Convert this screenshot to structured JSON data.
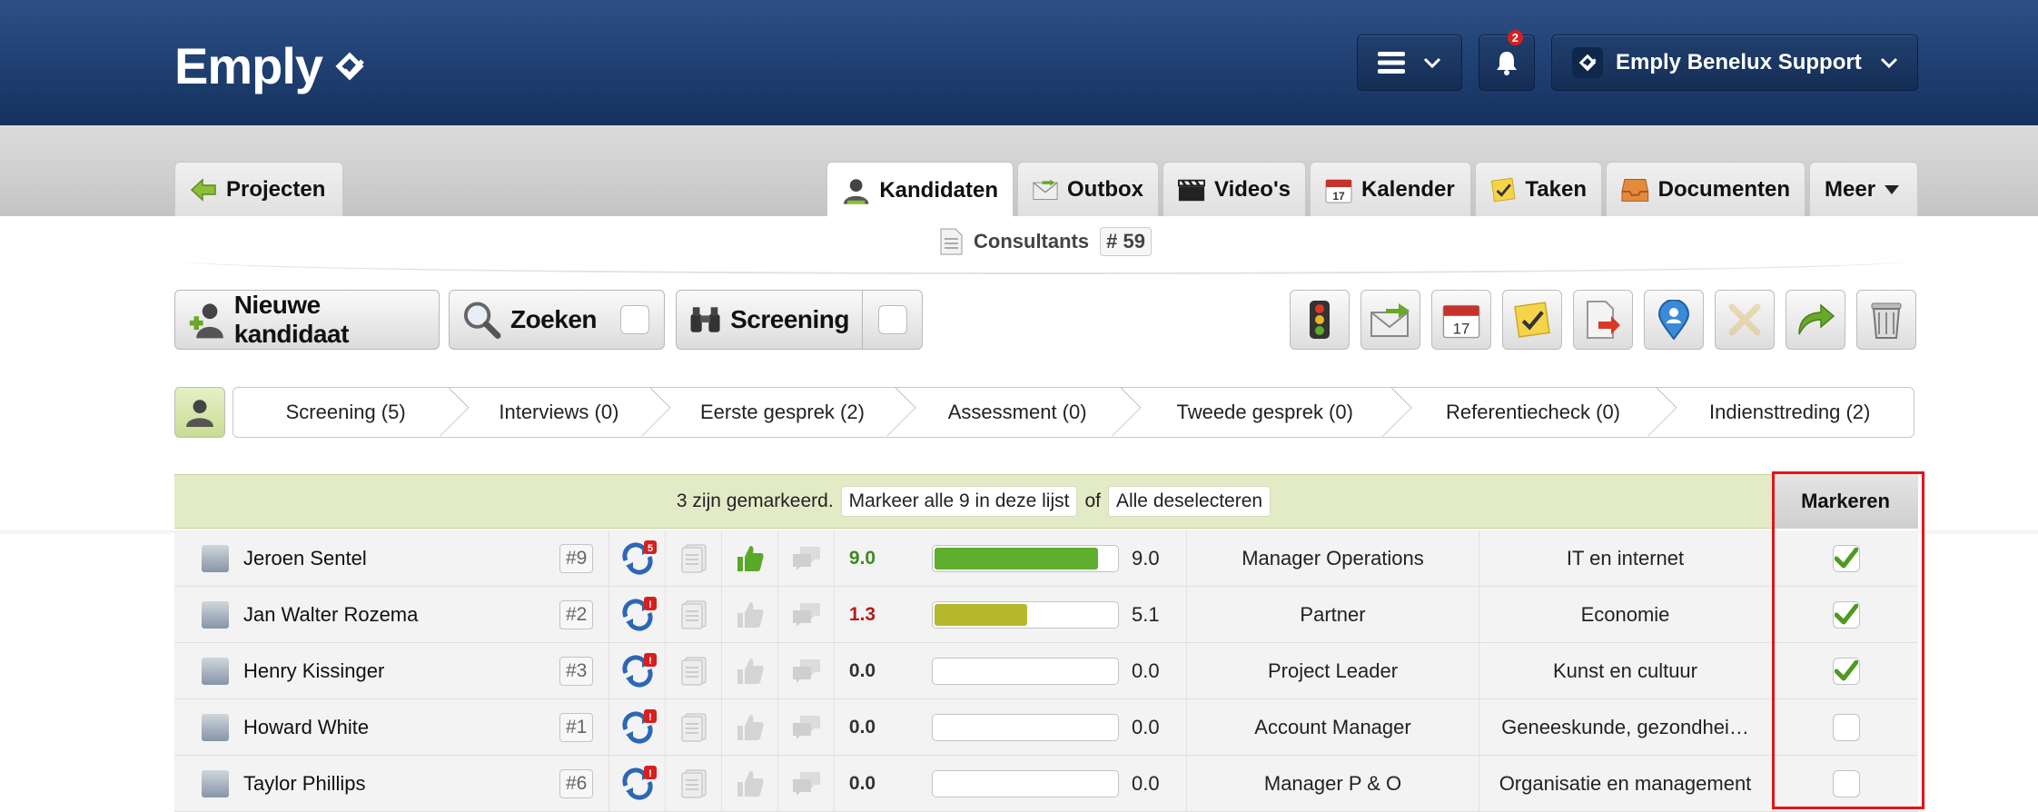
{
  "header": {
    "logo_text": "Emply",
    "notification_count": "2",
    "user_label": "Emply Benelux Support"
  },
  "nav": {
    "projects_label": "Projecten",
    "tabs": [
      {
        "label": "Kandidaten",
        "icon": "person-icon"
      },
      {
        "label": "Outbox",
        "icon": "envelope-icon"
      },
      {
        "label": "Video's",
        "icon": "clapper-icon"
      },
      {
        "label": "Kalender",
        "icon": "calendar-icon"
      },
      {
        "label": "Taken",
        "icon": "task-icon"
      },
      {
        "label": "Documenten",
        "icon": "inbox-icon"
      },
      {
        "label": "Meer",
        "icon": "caret-down-icon"
      }
    ]
  },
  "context": {
    "title": "Consultants",
    "number": "# 59"
  },
  "toolbar": {
    "new_candidate": "Nieuwe kandidaat",
    "search": "Zoeken",
    "screening": "Screening"
  },
  "pipeline": {
    "stages": [
      "Screening (5)",
      "Interviews (0)",
      "Eerste gesprek (2)",
      "Assessment (0)",
      "Tweede gesprek (0)",
      "Referentiecheck (0)",
      "Indiensttreding (2)"
    ]
  },
  "selection": {
    "status": "3 zijn gemarkeerd.",
    "select_all": "Markeer alle 9 in deze lijst",
    "or": "of",
    "deselect": "Alle deselecteren",
    "column_header": "Markeren"
  },
  "candidates": [
    {
      "name": "Jeroen Sentel",
      "rank": "#9",
      "sync_badge": "5",
      "liked": true,
      "score": "9.0",
      "score_color": "#3f8a1e",
      "rating": "9.0",
      "rating_pct": 90,
      "bar_color": "#5fae2e",
      "function": "Manager Operations",
      "category": "IT en internet",
      "marked": true
    },
    {
      "name": "Jan Walter Rozema",
      "rank": "#2",
      "sync_badge": "!",
      "liked": false,
      "score": "1.3",
      "score_color": "#b21d1d",
      "rating": "5.1",
      "rating_pct": 51,
      "bar_color": "#b6b82c",
      "function": "Partner",
      "category": "Economie",
      "marked": true
    },
    {
      "name": "Henry Kissinger",
      "rank": "#3",
      "sync_badge": "!",
      "liked": false,
      "score": "0.0",
      "score_color": "#333333",
      "rating": "0.0",
      "rating_pct": 0,
      "bar_color": "#5fae2e",
      "function": "Project Leader",
      "category": "Kunst en cultuur",
      "marked": true
    },
    {
      "name": "Howard White",
      "rank": "#1",
      "sync_badge": "!",
      "liked": false,
      "score": "0.0",
      "score_color": "#333333",
      "rating": "0.0",
      "rating_pct": 0,
      "bar_color": "#5fae2e",
      "function": "Account Manager",
      "category": "Geneeskunde, gezondhei…",
      "marked": false
    },
    {
      "name": "Taylor Phillips",
      "rank": "#6",
      "sync_badge": "!",
      "liked": false,
      "score": "0.0",
      "score_color": "#333333",
      "rating": "0.0",
      "rating_pct": 0,
      "bar_color": "#5fae2e",
      "function": "Manager P & O",
      "category": "Organisatie en management",
      "marked": false
    }
  ]
}
